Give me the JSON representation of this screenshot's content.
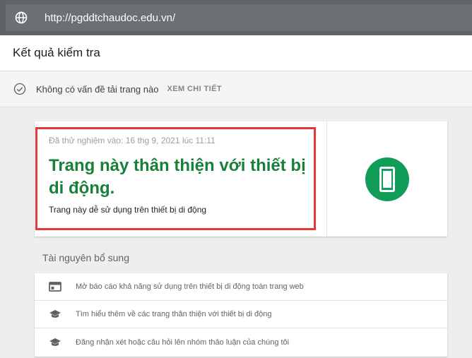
{
  "urlbar": {
    "url": "http://pgddtchaudoc.edu.vn/",
    "icon": "globe-icon"
  },
  "header": {
    "title": "Kết quả kiểm tra"
  },
  "status": {
    "icon": "check-circle-icon",
    "text": "Không có vấn đề tải trang nào",
    "details_link": "XEM CHI TIẾT"
  },
  "result": {
    "tested_on": "Đã thử nghiệm vào: 16 thg 9, 2021 lúc 11:11",
    "headline": "Trang này thân thiện với thiết bị di động.",
    "subtext": "Trang này dễ sử dụng trên thiết bị di động",
    "icon": "smartphone-icon",
    "colors": {
      "headline": "#188038",
      "badge": "#0f9d58",
      "highlight": "#e53935"
    }
  },
  "resources": {
    "title": "Tài nguyên bổ sung",
    "items": [
      {
        "label": "Mở báo cáo khả năng sử dụng trên thiết bị di động toàn trang web",
        "icon": "web-report-icon"
      },
      {
        "label": "Tìm hiểu thêm về các trang thân thiện với thiết bị di động",
        "icon": "graduation-cap-icon"
      },
      {
        "label": "Đăng nhận xét hoặc câu hỏi lên nhóm thảo luận của chúng tôi",
        "icon": "graduation-cap-icon"
      }
    ]
  }
}
